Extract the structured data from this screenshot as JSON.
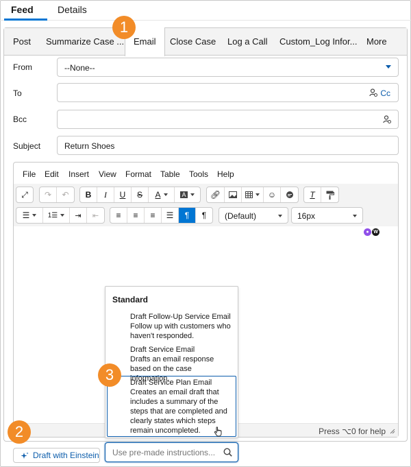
{
  "top_tabs": [
    {
      "label": "Feed",
      "active": true
    },
    {
      "label": "Details",
      "active": false
    }
  ],
  "action_tabs": [
    {
      "label": "Post"
    },
    {
      "label": "Summarize Case ..."
    },
    {
      "label": "Email",
      "active": true
    },
    {
      "label": "Close Case"
    },
    {
      "label": "Log a Call"
    },
    {
      "label": "Custom_Log Infor..."
    },
    {
      "label": "More"
    }
  ],
  "form": {
    "from_label": "From",
    "from_value": "--None--",
    "to_label": "To",
    "cc_label": "Cc",
    "bcc_label": "Bcc",
    "subject_label": "Subject",
    "subject_value": "Return Shoes"
  },
  "editor": {
    "menu": [
      "File",
      "Edit",
      "Insert",
      "View",
      "Format",
      "Table",
      "Tools",
      "Help"
    ],
    "font_family": "(Default)",
    "font_size": "16px",
    "status_text": "Press ⌥0 for help"
  },
  "instructions_dropdown": {
    "heading": "Standard",
    "items": [
      {
        "title": "Draft Follow-Up Service Email",
        "description": "Follow up with customers who haven't responded."
      },
      {
        "title": "Draft Service Email",
        "description": "Drafts an email response based on the case information."
      },
      {
        "title": "Draft Service Plan Email",
        "description": "Creates an email draft that includes a summary of the steps that are completed and clearly states which steps remain uncompleted.",
        "highlighted": true
      }
    ],
    "search_placeholder": "Use pre-made instructions..."
  },
  "einstein_button_label": "Draft with Einstein",
  "callouts": [
    "1",
    "2",
    "3"
  ],
  "colors": {
    "accent": "#0176d3",
    "link": "#0b5cab",
    "callout": "#f28c28"
  }
}
